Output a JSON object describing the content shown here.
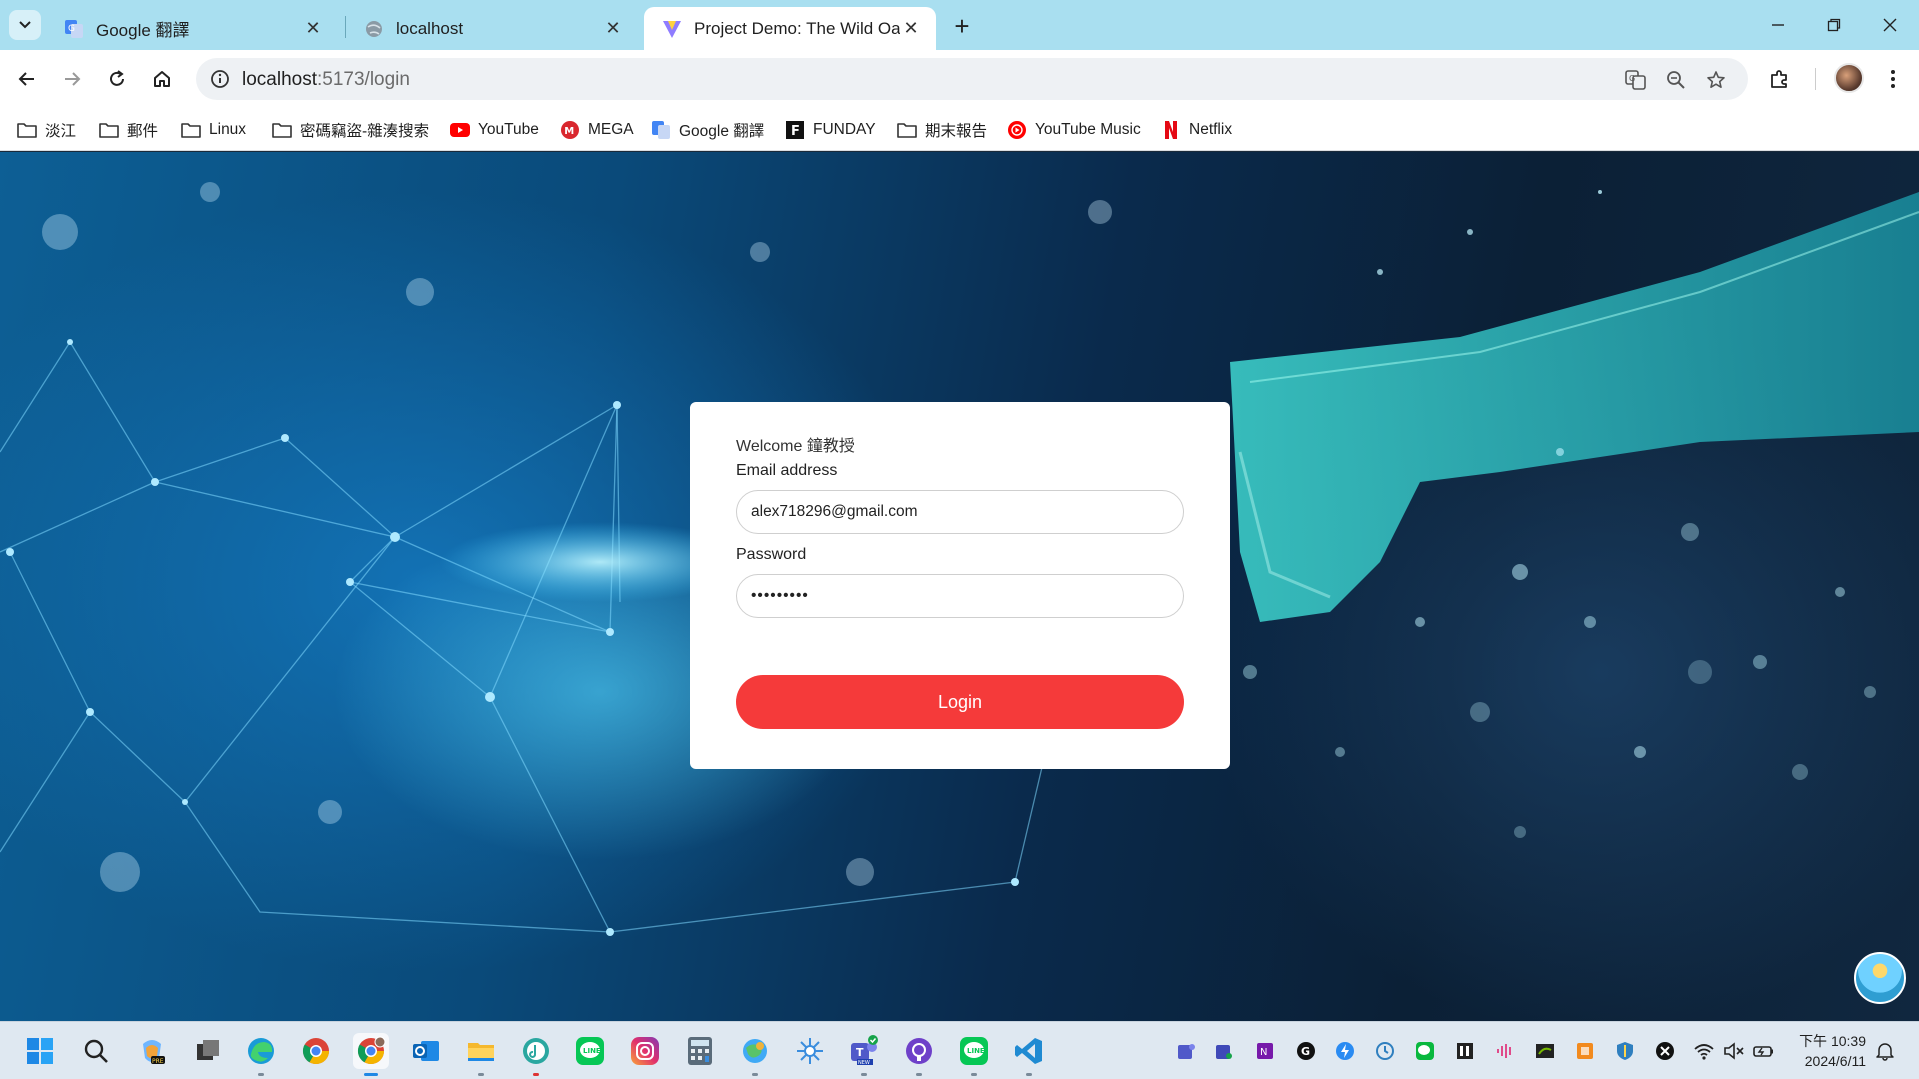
{
  "browser": {
    "tabs": [
      {
        "title": "Google 翻譯",
        "favicon": "google-translate-icon",
        "active": false
      },
      {
        "title": "localhost",
        "favicon": "globe-icon",
        "active": false
      },
      {
        "title": "Project Demo: The Wild Oasis",
        "favicon": "vite-icon",
        "active": true
      }
    ],
    "url_host": "localhost",
    "url_path": ":5173/login"
  },
  "bookmarks": [
    {
      "label": "淡江",
      "icon": "folder-icon"
    },
    {
      "label": "郵件",
      "icon": "folder-icon"
    },
    {
      "label": "Linux",
      "icon": "folder-icon"
    },
    {
      "label": "密碼竊盜-雜湊搜索",
      "icon": "folder-icon"
    },
    {
      "label": "YouTube",
      "icon": "youtube-icon"
    },
    {
      "label": "MEGA",
      "icon": "mega-icon"
    },
    {
      "label": "Google 翻譯",
      "icon": "google-translate-icon"
    },
    {
      "label": "FUNDAY",
      "icon": "funday-icon"
    },
    {
      "label": "期末報告",
      "icon": "folder-icon"
    },
    {
      "label": "YouTube Music",
      "icon": "youtube-music-icon"
    },
    {
      "label": "Netflix",
      "icon": "netflix-icon"
    }
  ],
  "login": {
    "welcome": "Welcome 鐘教授",
    "email_label": "Email address",
    "email_value": "alex718296@gmail.com",
    "password_label": "Password",
    "password_value": "•••••••••",
    "button_label": "Login"
  },
  "colors": {
    "accent": "#f53a3a",
    "tabstrip": "#a9dff0"
  },
  "taskbar": {
    "apps": [
      "start-icon",
      "search-icon",
      "copilot-icon",
      "task-view-icon",
      "edge-icon",
      "chrome-icon",
      "chrome-profile-icon",
      "outlook-icon",
      "file-explorer-icon",
      "music-icon",
      "line-icon",
      "instagram-icon",
      "calculator-icon",
      "maps-icon",
      "snipping-icon",
      "teams-new-icon",
      "github-icon",
      "line-icon",
      "vscode-icon"
    ],
    "time": "下午 10:39",
    "date": "2024/6/11"
  }
}
